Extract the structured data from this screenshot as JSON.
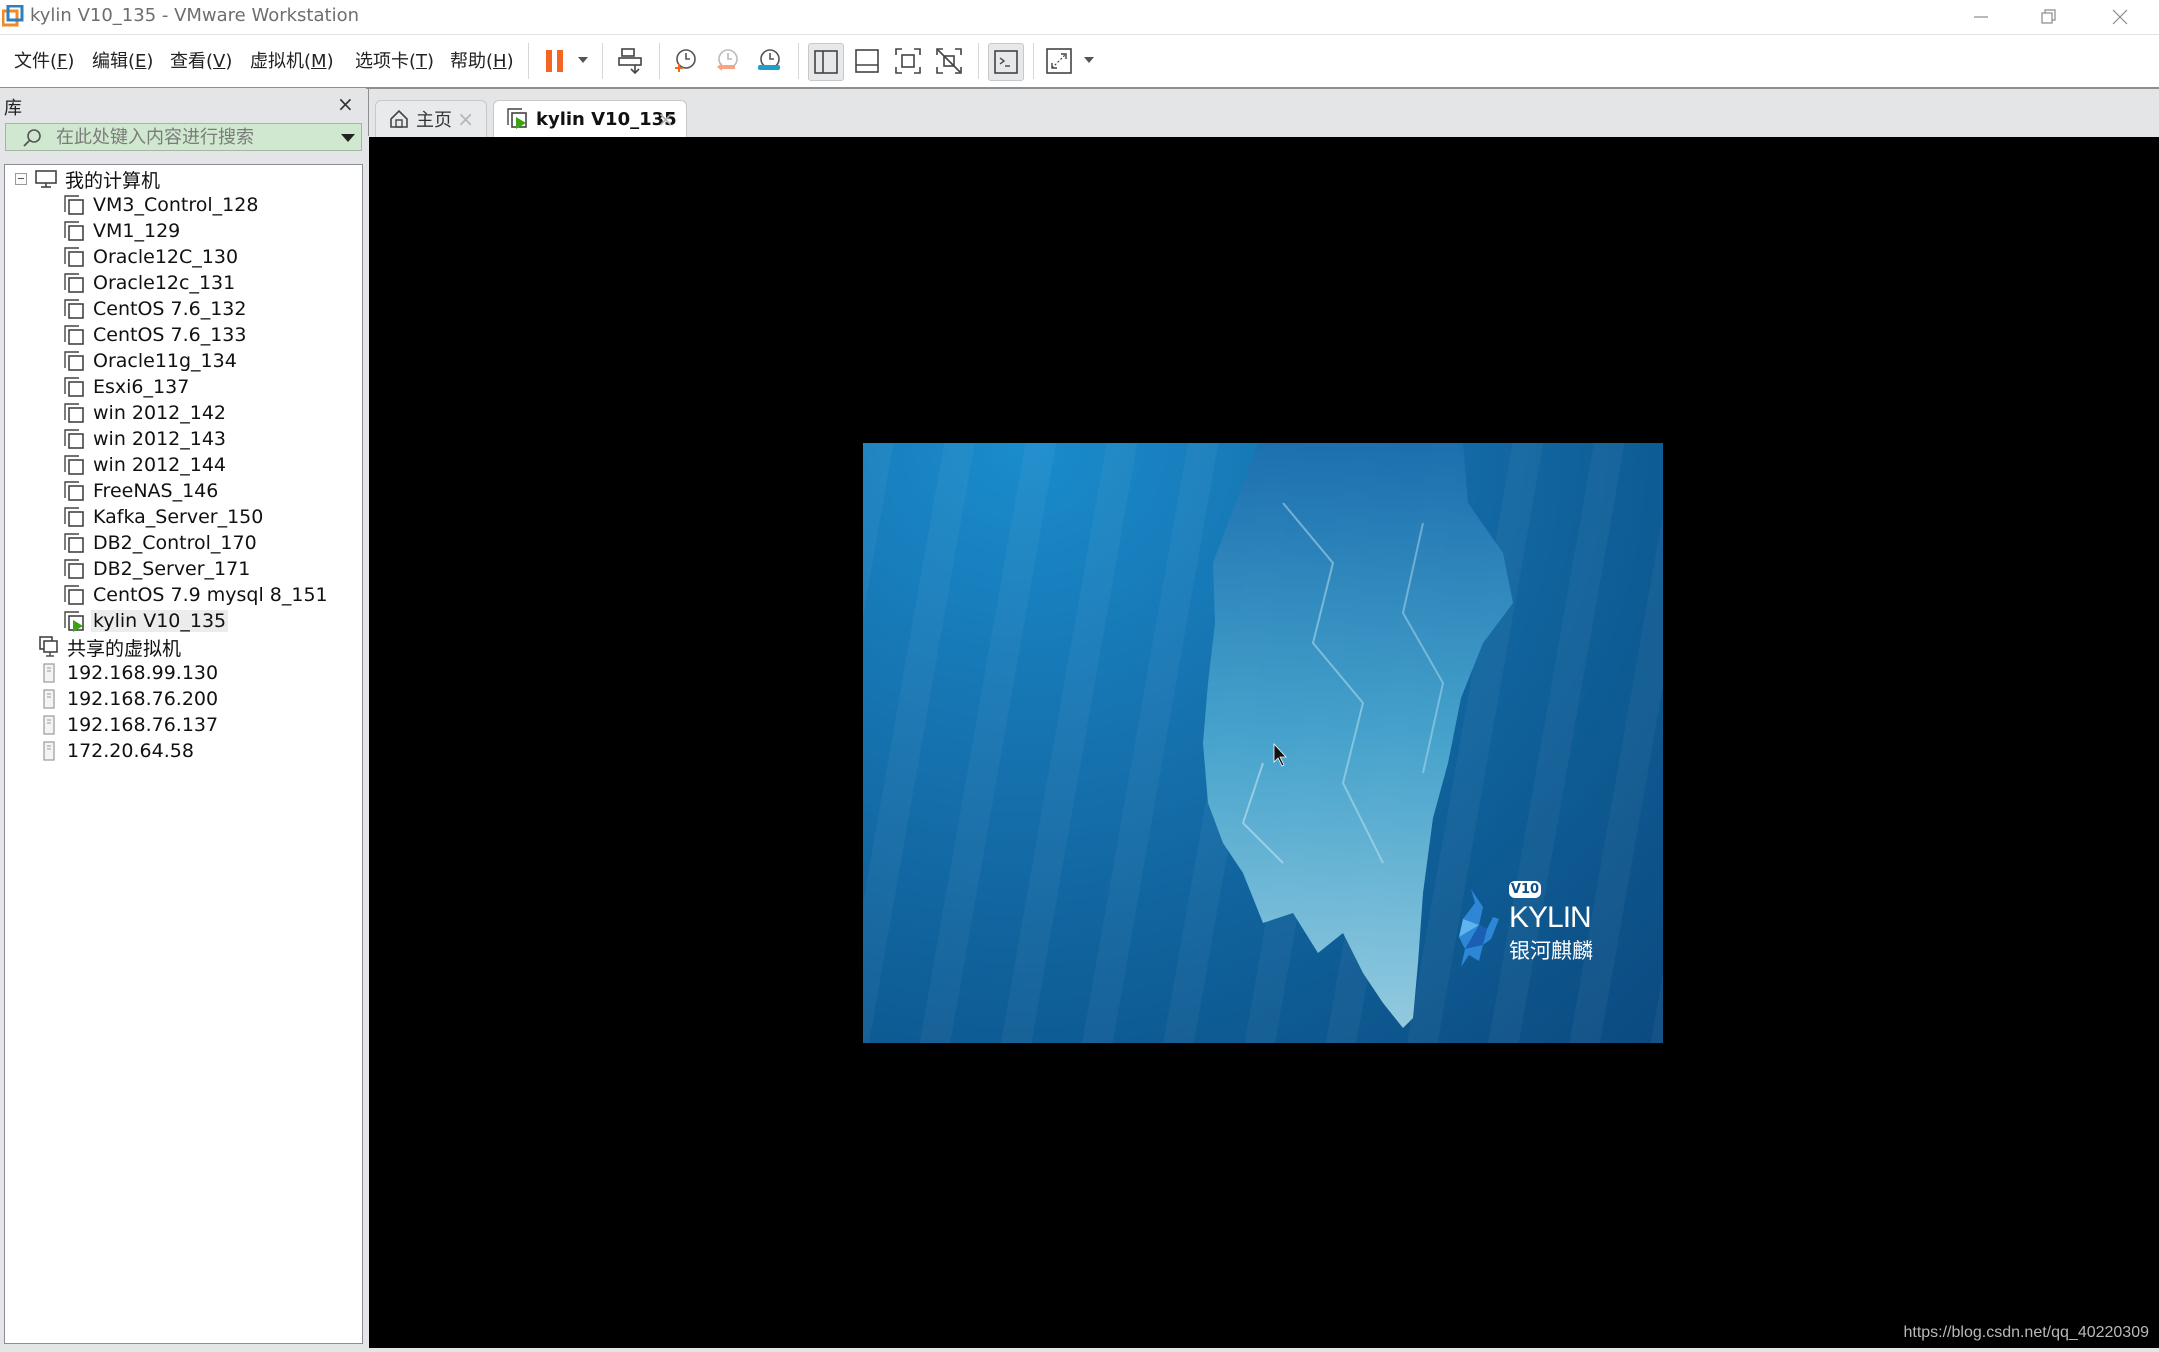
{
  "window": {
    "title": "kylin V10_135 - VMware Workstation",
    "controls": [
      "minimize",
      "restore",
      "close"
    ]
  },
  "menubar": {
    "items": [
      {
        "label": "文件(F)",
        "base": "文件(",
        "key": "F"
      },
      {
        "label": "编辑(E)",
        "base": "编辑(",
        "key": "E"
      },
      {
        "label": "查看(V)",
        "base": "查看(",
        "key": "V"
      },
      {
        "label": "虚拟机(M)",
        "base": "虚拟机(",
        "key": "M"
      },
      {
        "label": "选项卡(T)",
        "base": "选项卡(",
        "key": "T"
      },
      {
        "label": "帮助(H)",
        "base": "帮助(",
        "key": "H"
      }
    ],
    "close_paren": ")"
  },
  "toolbar": {
    "buttons": [
      {
        "name": "pause-vm",
        "icon": "pause-icon",
        "has_dropdown": true,
        "color": "#f26522"
      },
      {
        "name": "send-ctrl-alt-del",
        "icon": "send-keys-icon"
      },
      {
        "name": "take-snapshot",
        "icon": "snapshot-take-icon"
      },
      {
        "name": "revert-snapshot",
        "icon": "snapshot-revert-icon"
      },
      {
        "name": "snapshot-manager",
        "icon": "snapshot-manager-icon"
      },
      {
        "name": "show-library",
        "icon": "library-view-icon",
        "active": true
      },
      {
        "name": "show-thumbnail-bar",
        "icon": "thumbnail-bar-icon"
      },
      {
        "name": "full-screen",
        "icon": "fullscreen-icon"
      },
      {
        "name": "unity",
        "icon": "unity-icon"
      },
      {
        "name": "console-view",
        "icon": "console-icon",
        "active": true
      },
      {
        "name": "stretch-guest",
        "icon": "stretch-icon",
        "has_dropdown": true
      }
    ]
  },
  "library": {
    "title": "库",
    "close_label": "×",
    "search_placeholder": "在此处键入内容进行搜索",
    "tree": {
      "my_computer": {
        "label": "我的计算机",
        "expanded": true,
        "vms": [
          {
            "label": "VM3_Control_128",
            "running": false
          },
          {
            "label": "VM1_129",
            "running": false
          },
          {
            "label": "Oracle12C_130",
            "running": false
          },
          {
            "label": "Oracle12c_131",
            "running": false
          },
          {
            "label": "CentOS 7.6_132",
            "running": false
          },
          {
            "label": "CentOS 7.6_133",
            "running": false
          },
          {
            "label": "Oracle11g_134",
            "running": false
          },
          {
            "label": "Esxi6_137",
            "running": false
          },
          {
            "label": "win 2012_142",
            "running": false
          },
          {
            "label": "win 2012_143",
            "running": false
          },
          {
            "label": "win 2012_144",
            "running": false
          },
          {
            "label": "FreeNAS_146",
            "running": false
          },
          {
            "label": "Kafka_Server_150",
            "running": false
          },
          {
            "label": "DB2_Control_170",
            "running": false
          },
          {
            "label": "DB2_Server_171",
            "running": false
          },
          {
            "label": "CentOS 7.9 mysql 8_151",
            "running": false
          },
          {
            "label": "kylin V10_135",
            "running": true,
            "selected": true
          }
        ]
      },
      "shared": {
        "label": "共享的虚拟机"
      },
      "remote_hosts": [
        {
          "label": "192.168.99.130"
        },
        {
          "label": "192.168.76.200"
        },
        {
          "label": "192.168.76.137"
        },
        {
          "label": "172.20.64.58"
        }
      ]
    }
  },
  "tabs": [
    {
      "label": "主页",
      "icon": "home-icon",
      "active": false
    },
    {
      "label": "kylin V10_135",
      "icon": "vm-running-icon",
      "active": true
    }
  ],
  "tab_close_label": "×",
  "guest": {
    "brand": "KYLIN",
    "version_badge": "V10",
    "brand_cn": "银河麒麟"
  },
  "watermark": "https://blog.csdn.net/qq_40220309",
  "colors": {
    "search_bg": "#cfe8cf",
    "pause_orange": "#f26522",
    "running_green": "#3aa312",
    "snapshot_revert": "#f4a582",
    "snapshot_manager": "#1da1c9"
  }
}
